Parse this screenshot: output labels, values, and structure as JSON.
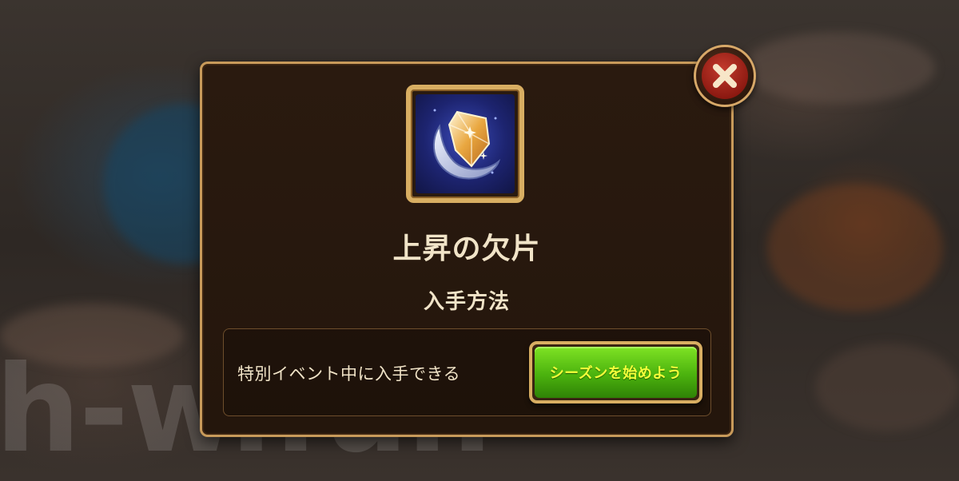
{
  "watermark": {
    "text": "h-w.fun"
  },
  "dialog": {
    "item_name": "上昇の欠片",
    "section_title": "入手方法",
    "source": {
      "description": "特別イベント中に入手できる",
      "button_label": "シーズンを始めよう"
    }
  },
  "icons": {
    "close": "close-x-icon",
    "item": "ascension-shard-icon"
  },
  "colors": {
    "frame_gold": "#d8ae62",
    "panel_bg": "#2a1a0f",
    "text_cream": "#f1e4c8",
    "button_green": "#4bb20e",
    "button_text_yellow": "#f4ff3a",
    "close_red": "#c23a2c"
  }
}
